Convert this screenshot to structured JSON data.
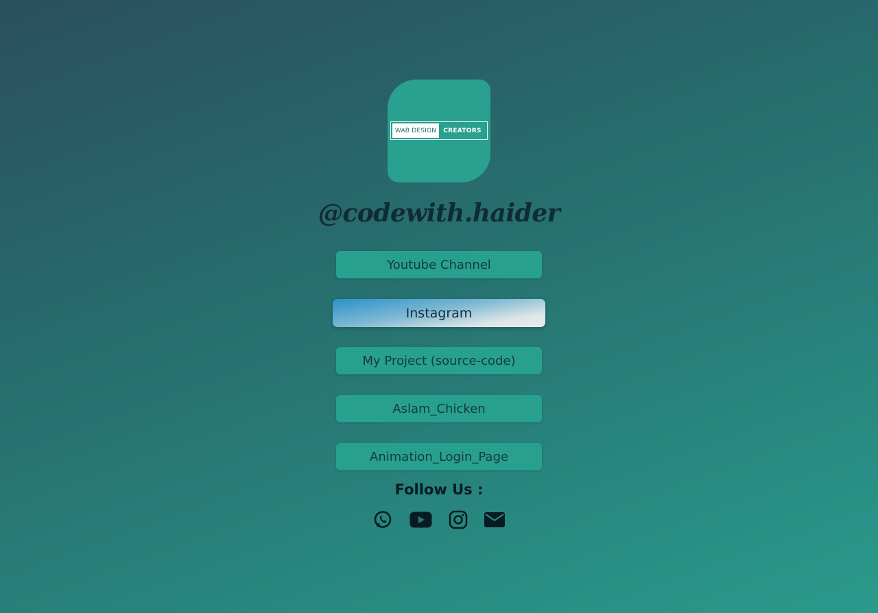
{
  "brand": {
    "logo_left_text": "WAB DESIGN",
    "logo_right_text": "CREATORS",
    "handle": "@codewith.haider"
  },
  "links": [
    {
      "label": "Youtube Channel",
      "active": false
    },
    {
      "label": "Instagram",
      "active": true
    },
    {
      "label": "My Project (source-code)",
      "active": false
    },
    {
      "label": "Aslam_Chicken",
      "active": false
    },
    {
      "label": "Animation_Login_Page",
      "active": false
    }
  ],
  "follow": {
    "heading": "Follow Us :",
    "icons": [
      "whatsapp-icon",
      "youtube-icon",
      "instagram-icon",
      "email-icon"
    ]
  },
  "colors": {
    "accent": "#27a08f",
    "text_dark": "#0f2b33"
  }
}
